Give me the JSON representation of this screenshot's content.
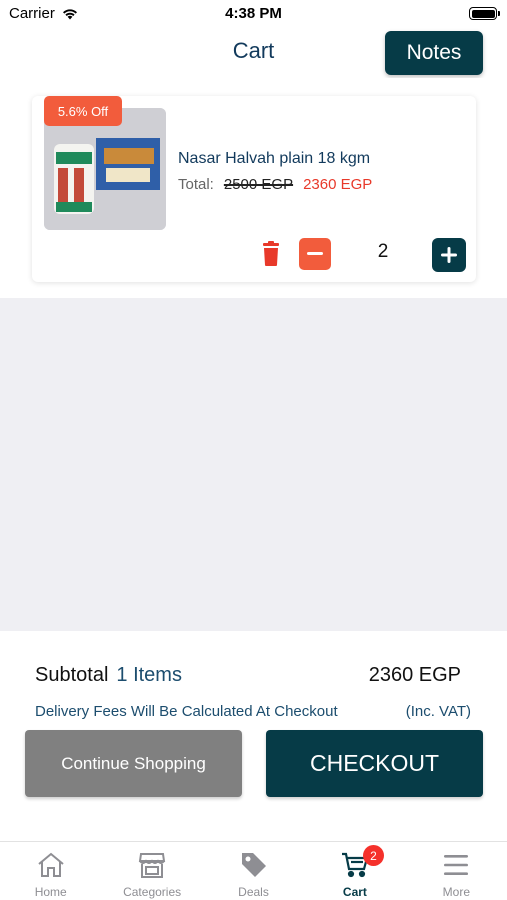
{
  "status_bar": {
    "carrier": "Carrier",
    "time": "4:38 PM"
  },
  "header": {
    "title": "Cart",
    "notes_label": "Notes"
  },
  "cart_items": [
    {
      "discount": "5.6% Off",
      "name": "Nasar Halvah plain 18 kgm",
      "total_label": "Total:",
      "old_price": "2500 EGP",
      "new_price": "2360 EGP",
      "quantity": "2"
    }
  ],
  "summary": {
    "subtotal_label": "Subtotal",
    "items_count": "1 Items",
    "subtotal_amount": "2360 EGP",
    "delivery_note": "Delivery Fees Will Be Calculated At Checkout",
    "vat_note": "(Inc. VAT)",
    "continue_label": "Continue Shopping",
    "checkout_label": "CHECKOUT"
  },
  "tab_bar": {
    "tabs": [
      {
        "label": "Home",
        "icon": "home-icon"
      },
      {
        "label": "Categories",
        "icon": "store-icon"
      },
      {
        "label": "Deals",
        "icon": "tag-icon"
      },
      {
        "label": "Cart",
        "icon": "cart-icon",
        "badge": "2",
        "active": true
      },
      {
        "label": "More",
        "icon": "menu-icon"
      }
    ]
  },
  "colors": {
    "primary": "#063b47",
    "accent": "#f25c3c",
    "sale_price": "#e8392a",
    "title_text": "#123a5c",
    "secondary_button": "#808080",
    "badge": "#f5312b"
  }
}
